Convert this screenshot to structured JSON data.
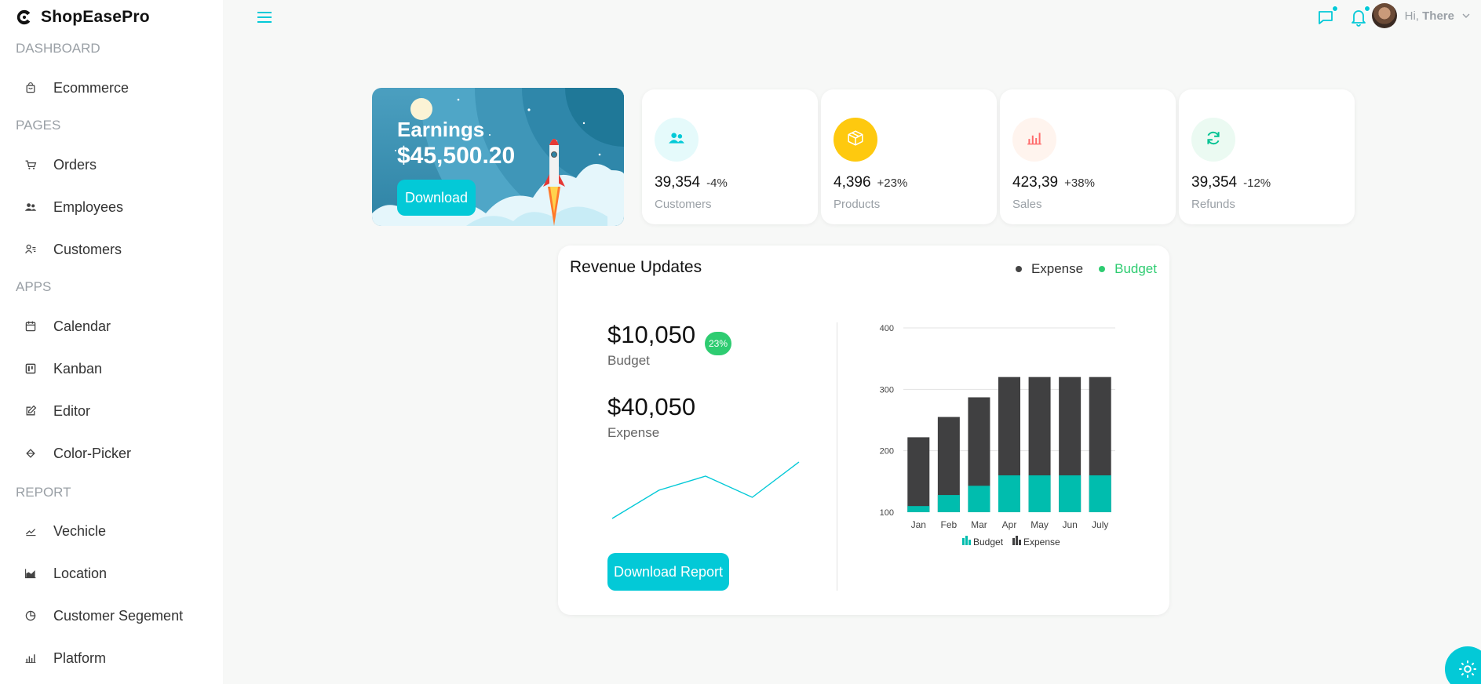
{
  "brand": {
    "name": "ShopEasePro"
  },
  "sidebar": {
    "sections": [
      {
        "title": "DASHBOARD",
        "items": [
          {
            "label": "Ecommerce",
            "icon": "shopping-bag-icon"
          }
        ]
      },
      {
        "title": "PAGES",
        "items": [
          {
            "label": "Orders",
            "icon": "cart-icon"
          },
          {
            "label": "Employees",
            "icon": "users-icon"
          },
          {
            "label": "Customers",
            "icon": "customer-icon"
          }
        ]
      },
      {
        "title": "APPS",
        "items": [
          {
            "label": "Calendar",
            "icon": "calendar-icon"
          },
          {
            "label": "Kanban",
            "icon": "kanban-icon"
          },
          {
            "label": "Editor",
            "icon": "edit-icon"
          },
          {
            "label": "Color-Picker",
            "icon": "paint-bucket-icon"
          }
        ]
      },
      {
        "title": "REPORT",
        "items": [
          {
            "label": "Vechicle",
            "icon": "line-chart-icon"
          },
          {
            "label": "Location",
            "icon": "area-chart-icon"
          },
          {
            "label": "Customer Segement",
            "icon": "pie-chart-icon"
          },
          {
            "label": "Platform",
            "icon": "bar-chart-icon"
          }
        ]
      }
    ]
  },
  "topbar": {
    "greeting": "Hi,",
    "username": "There"
  },
  "earnings": {
    "title": "Earnings",
    "value": "$45,500.20",
    "button": "Download"
  },
  "stats": [
    {
      "amount": "39,354",
      "percent": "-4%",
      "title": "Customers",
      "icon": "users-icon",
      "bg": "#e5fafb",
      "color": "#03c9d7"
    },
    {
      "amount": "4,396",
      "percent": "+23%",
      "title": "Products",
      "icon": "box-icon",
      "bg": "#fec90f",
      "color": "#ffffff"
    },
    {
      "amount": "423,39",
      "percent": "+38%",
      "title": "Sales",
      "icon": "bar-chart-icon",
      "bg": "#fff4ee",
      "color": "#ff6a6a"
    },
    {
      "amount": "39,354",
      "percent": "-12%",
      "title": "Refunds",
      "icon": "refresh-icon",
      "bg": "#ebfaf2",
      "color": "#00c292"
    }
  ],
  "revenue": {
    "title": "Revenue Updates",
    "legend": [
      {
        "label": "Expense",
        "color": "#444444"
      },
      {
        "label": "Budget",
        "color": "#2ecc71"
      }
    ],
    "budget_value": "$10,050",
    "budget_label": "Budget",
    "budget_badge": "23%",
    "expense_value": "$40,050",
    "expense_label": "Expense",
    "button": "Download Report",
    "accent": "#03c9d7"
  },
  "sparkline": {
    "values": [
      1,
      5,
      7,
      4,
      9
    ]
  },
  "chart_data": {
    "type": "bar",
    "stacked": true,
    "categories": [
      "Jan",
      "Feb",
      "Mar",
      "Apr",
      "May",
      "Jun",
      "July"
    ],
    "series": [
      {
        "name": "Budget",
        "color": "#00bdae",
        "values": [
          110,
          128,
          143,
          160,
          160,
          160,
          160
        ]
      },
      {
        "name": "Expense",
        "color": "#404041",
        "values": [
          222,
          255,
          287,
          320,
          320,
          320,
          320
        ]
      }
    ],
    "ylim": [
      100,
      400
    ],
    "yticks": [
      100,
      200,
      300,
      400
    ],
    "grid": true,
    "legend_position": "bottom"
  }
}
